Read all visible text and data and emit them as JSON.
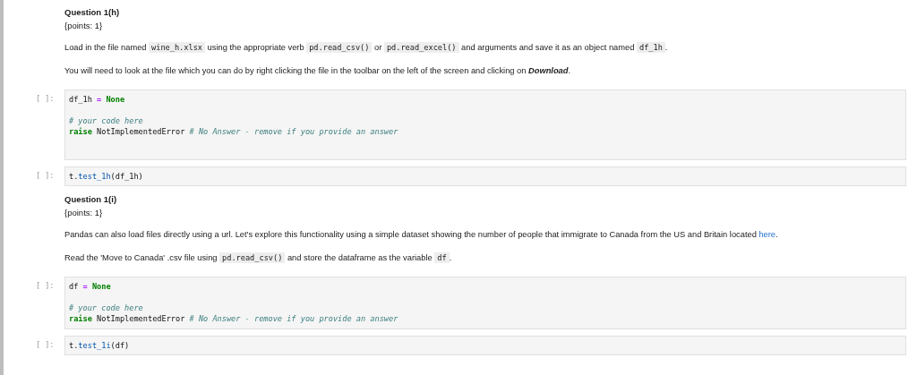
{
  "cells": [
    {
      "kind": "markdown",
      "title": "Question 1(h)",
      "points": "{points: 1}",
      "paragraphs": [
        [
          {
            "kind": "text",
            "text": "Load in the file named "
          },
          {
            "kind": "code",
            "text": "wine_h.xlsx"
          },
          {
            "kind": "text",
            "text": " using the appropriate verb "
          },
          {
            "kind": "code",
            "text": "pd.read_csv()"
          },
          {
            "kind": "text",
            "text": " or "
          },
          {
            "kind": "code",
            "text": "pd.read_excel()"
          },
          {
            "kind": "text",
            "text": " and arguments and save it as an object named "
          },
          {
            "kind": "code",
            "text": "df_1h"
          },
          {
            "kind": "text",
            "text": "."
          }
        ],
        [
          {
            "kind": "text",
            "text": "You will need to look at the file which you can do by right clicking the file in the toolbar on the left of the screen and clicking on "
          },
          {
            "kind": "emphasis",
            "text": "Download"
          },
          {
            "kind": "text",
            "text": "."
          }
        ]
      ]
    },
    {
      "kind": "code",
      "prompt": "[ ]:",
      "extra_space": true,
      "groups": [
        [
          [
            {
              "kind": "name",
              "text": "df_1h "
            },
            {
              "kind": "op",
              "text": "="
            },
            {
              "kind": "keyword",
              "text": " None"
            }
          ]
        ],
        [
          [
            {
              "kind": "comment",
              "text": "# your code here"
            }
          ],
          [
            {
              "kind": "keyword",
              "text": "raise"
            },
            {
              "kind": "name",
              "text": " NotImplementedError "
            },
            {
              "kind": "comment",
              "text": "# No Answer - remove if you provide an answer"
            }
          ]
        ]
      ]
    },
    {
      "kind": "code",
      "prompt": "[ ]:",
      "extra_space": false,
      "groups": [
        [
          [
            {
              "kind": "name",
              "text": "t."
            },
            {
              "kind": "call",
              "text": "test_1h"
            },
            {
              "kind": "name",
              "text": "(df_1h)"
            }
          ]
        ]
      ]
    },
    {
      "kind": "markdown",
      "title": "Question 1(i)",
      "points": "{points: 1}",
      "paragraphs": [
        [
          {
            "kind": "text",
            "text": "Pandas can also load files directly using a url. Let's explore this functionality using a simple dataset showing the number of people that immigrate to Canada from the US and Britain located "
          },
          {
            "kind": "link",
            "text": "here"
          },
          {
            "kind": "text",
            "text": "."
          }
        ],
        [
          {
            "kind": "text",
            "text": "Read the 'Move to Canada' .csv file using "
          },
          {
            "kind": "code",
            "text": "pd.read_csv()"
          },
          {
            "kind": "text",
            "text": " and store the dataframe as the variable "
          },
          {
            "kind": "code",
            "text": "df"
          },
          {
            "kind": "text",
            "text": "."
          }
        ]
      ]
    },
    {
      "kind": "code",
      "prompt": "[ ]:",
      "extra_space": false,
      "groups": [
        [
          [
            {
              "kind": "name",
              "text": "df "
            },
            {
              "kind": "op",
              "text": "="
            },
            {
              "kind": "keyword",
              "text": " None"
            }
          ]
        ],
        [
          [
            {
              "kind": "comment",
              "text": "# your code here"
            }
          ],
          [
            {
              "kind": "keyword",
              "text": "raise"
            },
            {
              "kind": "name",
              "text": " NotImplementedError "
            },
            {
              "kind": "comment",
              "text": "# No Answer - remove if you provide an answer"
            }
          ]
        ]
      ]
    },
    {
      "kind": "code",
      "prompt": "[ ]:",
      "extra_space": false,
      "groups": [
        [
          [
            {
              "kind": "name",
              "text": "t."
            },
            {
              "kind": "call",
              "text": "test_1i"
            },
            {
              "kind": "name",
              "text": "(df)"
            }
          ]
        ]
      ]
    }
  ]
}
